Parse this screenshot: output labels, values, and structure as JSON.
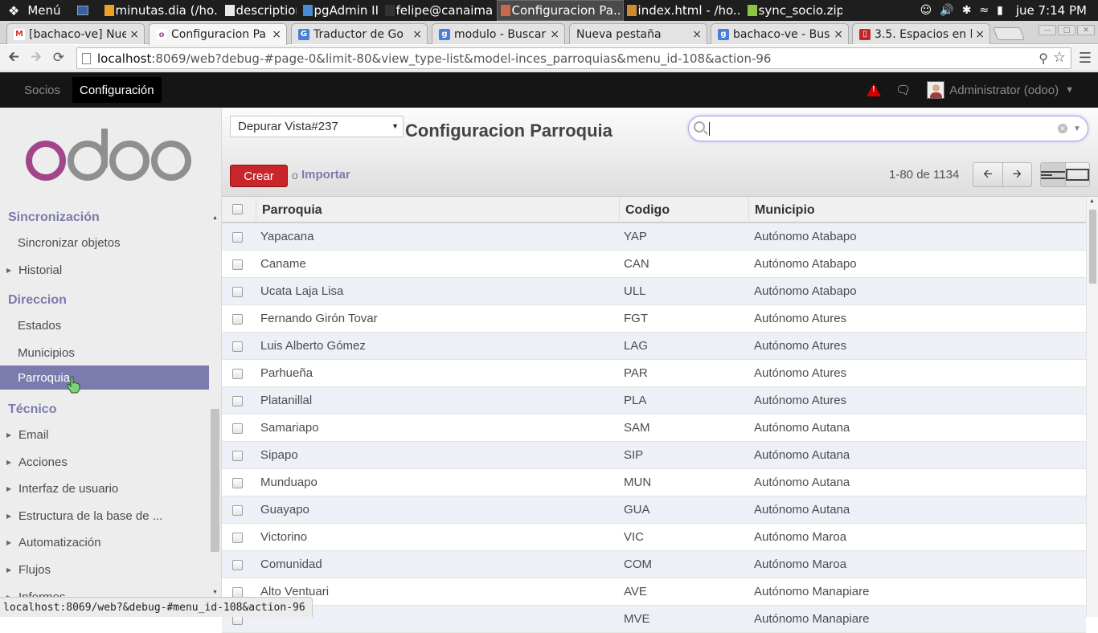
{
  "taskbar": {
    "menu_label": "Menú",
    "tasks": [
      {
        "label": "minutas.dia (/ho...",
        "color": "#f0a020"
      },
      {
        "label": "description",
        "color": "#e8e8e8"
      },
      {
        "label": "pgAdmin III",
        "color": "#4a8bd4"
      },
      {
        "label": "felipe@canaima-...",
        "color": "#333333"
      },
      {
        "label": "Configuracion Pa...",
        "color": "#c86a4a"
      },
      {
        "label": "index.html - /ho...",
        "color": "#d08a30"
      },
      {
        "label": "sync_socio.zip",
        "color": "#8cc63e"
      }
    ],
    "clock": "jue  7:14 PM"
  },
  "browser": {
    "tabs": [
      {
        "label": "[bachaco-ve] Nue",
        "icon": "gmail-icon"
      },
      {
        "label": "Configuracion Pa",
        "icon": "odoo-icon"
      },
      {
        "label": "Traductor de Go",
        "icon": "translate-icon"
      },
      {
        "label": "modulo - Buscar",
        "icon": "google-icon"
      },
      {
        "label": "Nueva pestaña",
        "icon": ""
      },
      {
        "label": "bachaco-ve - Bus",
        "icon": "google-icon"
      },
      {
        "label": "3.5. Espacios en b",
        "icon": "book-icon"
      }
    ],
    "url_host": "localhost",
    "url_rest": ":8069/web?debug-#page-0&limit-80&view_type-list&model-inces_parroquias&menu_id-108&action-96",
    "status_url": "localhost:8069/web?&debug-#menu_id-108&action-96"
  },
  "odoo": {
    "top_menu": [
      "Socios",
      "Configuración"
    ],
    "user": "Administrator (odoo)",
    "logo_text": "odoo",
    "sidebar": {
      "sections": [
        {
          "title": "Sincronización"
        },
        {
          "title": "Direccion"
        },
        {
          "title": "Técnico"
        }
      ],
      "sync_items": [
        "Sincronizar objetos",
        "Historial"
      ],
      "dir_items": [
        "Estados",
        "Municipios",
        "Parroquia"
      ],
      "tech_items": [
        "Email",
        "Acciones",
        "Interfaz de usuario",
        "Estructura de la base de ...",
        "Automatización",
        "Flujos",
        "Informes"
      ]
    },
    "control_panel": {
      "view_select": "Depurar Vista#237",
      "title": "Configuracion Parroquia",
      "search_value": "",
      "create_label": "Crear",
      "or_label": "o",
      "import_label": "Importar",
      "pager": "1-80 de 1134"
    },
    "columns": [
      "Parroquia",
      "Codigo",
      "Municipio"
    ],
    "rows": [
      [
        "Yapacana",
        "YAP",
        "Autónomo Atabapo"
      ],
      [
        "Caname",
        "CAN",
        "Autónomo Atabapo"
      ],
      [
        "Ucata Laja Lisa",
        "ULL",
        "Autónomo Atabapo"
      ],
      [
        "Fernando Girón Tovar",
        "FGT",
        "Autónomo Atures"
      ],
      [
        "Luis Alberto Gómez",
        "LAG",
        "Autónomo Atures"
      ],
      [
        "Parhueña",
        "PAR",
        "Autónomo Atures"
      ],
      [
        "Platanillal",
        "PLA",
        "Autónomo Atures"
      ],
      [
        "Samariapo",
        "SAM",
        "Autónomo Autana"
      ],
      [
        "Sipapo",
        "SIP",
        "Autónomo Autana"
      ],
      [
        "Munduapo",
        "MUN",
        "Autónomo Autana"
      ],
      [
        "Guayapo",
        "GUA",
        "Autónomo Autana"
      ],
      [
        "Victorino",
        "VIC",
        "Autónomo Maroa"
      ],
      [
        "Comunidad",
        "COM",
        "Autónomo Maroa"
      ],
      [
        "Alto Ventuari",
        "AVE",
        "Autónomo Manapiare"
      ],
      [
        "",
        "MVE",
        "Autónomo Manapiare"
      ]
    ]
  }
}
